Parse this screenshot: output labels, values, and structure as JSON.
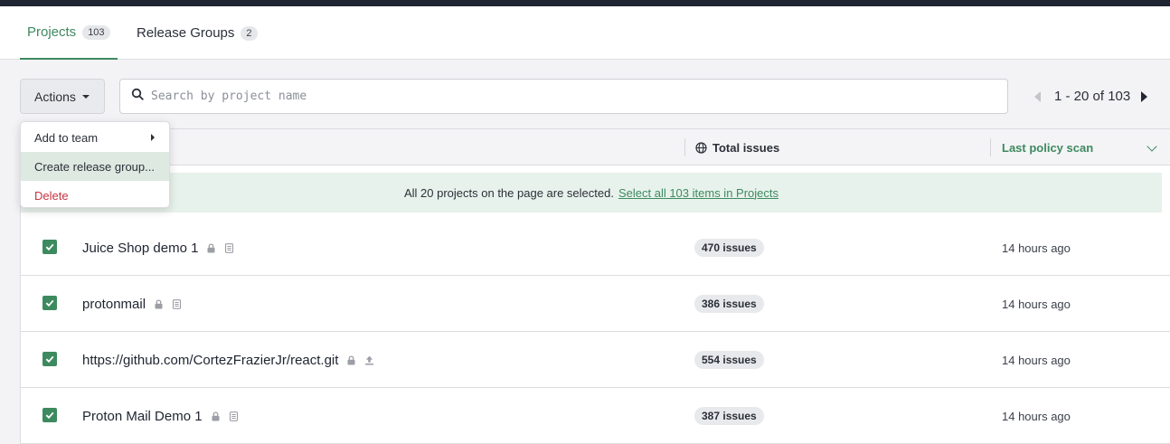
{
  "tabs": [
    {
      "label": "Projects",
      "count": "103",
      "active": true
    },
    {
      "label": "Release Groups",
      "count": "2",
      "active": false
    }
  ],
  "toolbar": {
    "actions_label": "Actions",
    "search_placeholder": "Search by project name",
    "pagination_text": "1 - 20 of 103"
  },
  "actions_menu": {
    "items": [
      "Add to team",
      "Create release group...",
      "Delete"
    ]
  },
  "table": {
    "columns": {
      "issues": "Total issues",
      "scan": "Last policy scan"
    },
    "banner_text": "All 20 projects on the page are selected.",
    "banner_link": "Select all 103 items in Projects",
    "rows": [
      {
        "name": "Juice Shop demo 1",
        "issues": "470 issues",
        "scan": "14 hours ago",
        "icons": [
          "lock-icon",
          "document-icon"
        ]
      },
      {
        "name": "protonmail",
        "issues": "386 issues",
        "scan": "14 hours ago",
        "icons": [
          "lock-icon",
          "document-icon"
        ]
      },
      {
        "name": "https://github.com/CortezFrazierJr/react.git",
        "issues": "554 issues",
        "scan": "14 hours ago",
        "icons": [
          "lock-icon",
          "upload-icon"
        ]
      },
      {
        "name": "Proton Mail Demo 1",
        "issues": "387 issues",
        "scan": "14 hours ago",
        "icons": [
          "lock-icon",
          "document-icon"
        ]
      }
    ]
  },
  "colors": {
    "accent": "#3d8a5f",
    "danger": "#c8323f",
    "banner_bg": "#e8f2ec"
  }
}
